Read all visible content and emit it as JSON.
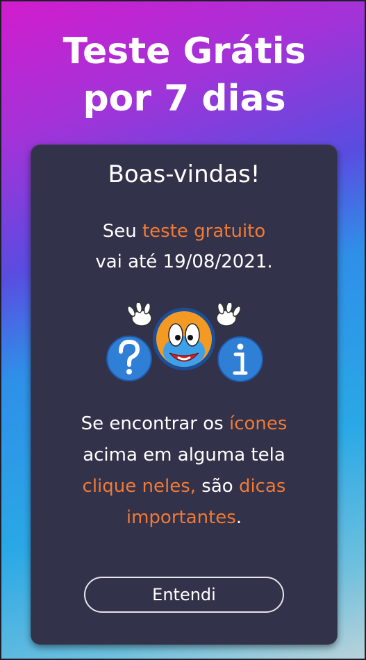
{
  "headline": {
    "line1": "Teste Grátis",
    "line2": "por 7 dias"
  },
  "dialog": {
    "title": "Boas-vindas!",
    "trial": {
      "prefix": "Seu ",
      "highlight": "teste gratuito",
      "line2_prefix": "vai até ",
      "end_date": "19/08/2021",
      "line2_suffix": "."
    },
    "tip": {
      "p1": "Se encontrar os ",
      "h1": "ícones",
      "p2": "acima em alguma tela",
      "h2": "clique neles,",
      "p3": " são ",
      "h3": "dicas",
      "h4": "importantes",
      "p4": "."
    },
    "button_label": "Entendi"
  },
  "colors": {
    "accent": "#f07a36",
    "card": "#32324a",
    "icon_blue": "#2f7fd6"
  },
  "icons": [
    "question-icon",
    "mascot-icon",
    "info-icon"
  ]
}
